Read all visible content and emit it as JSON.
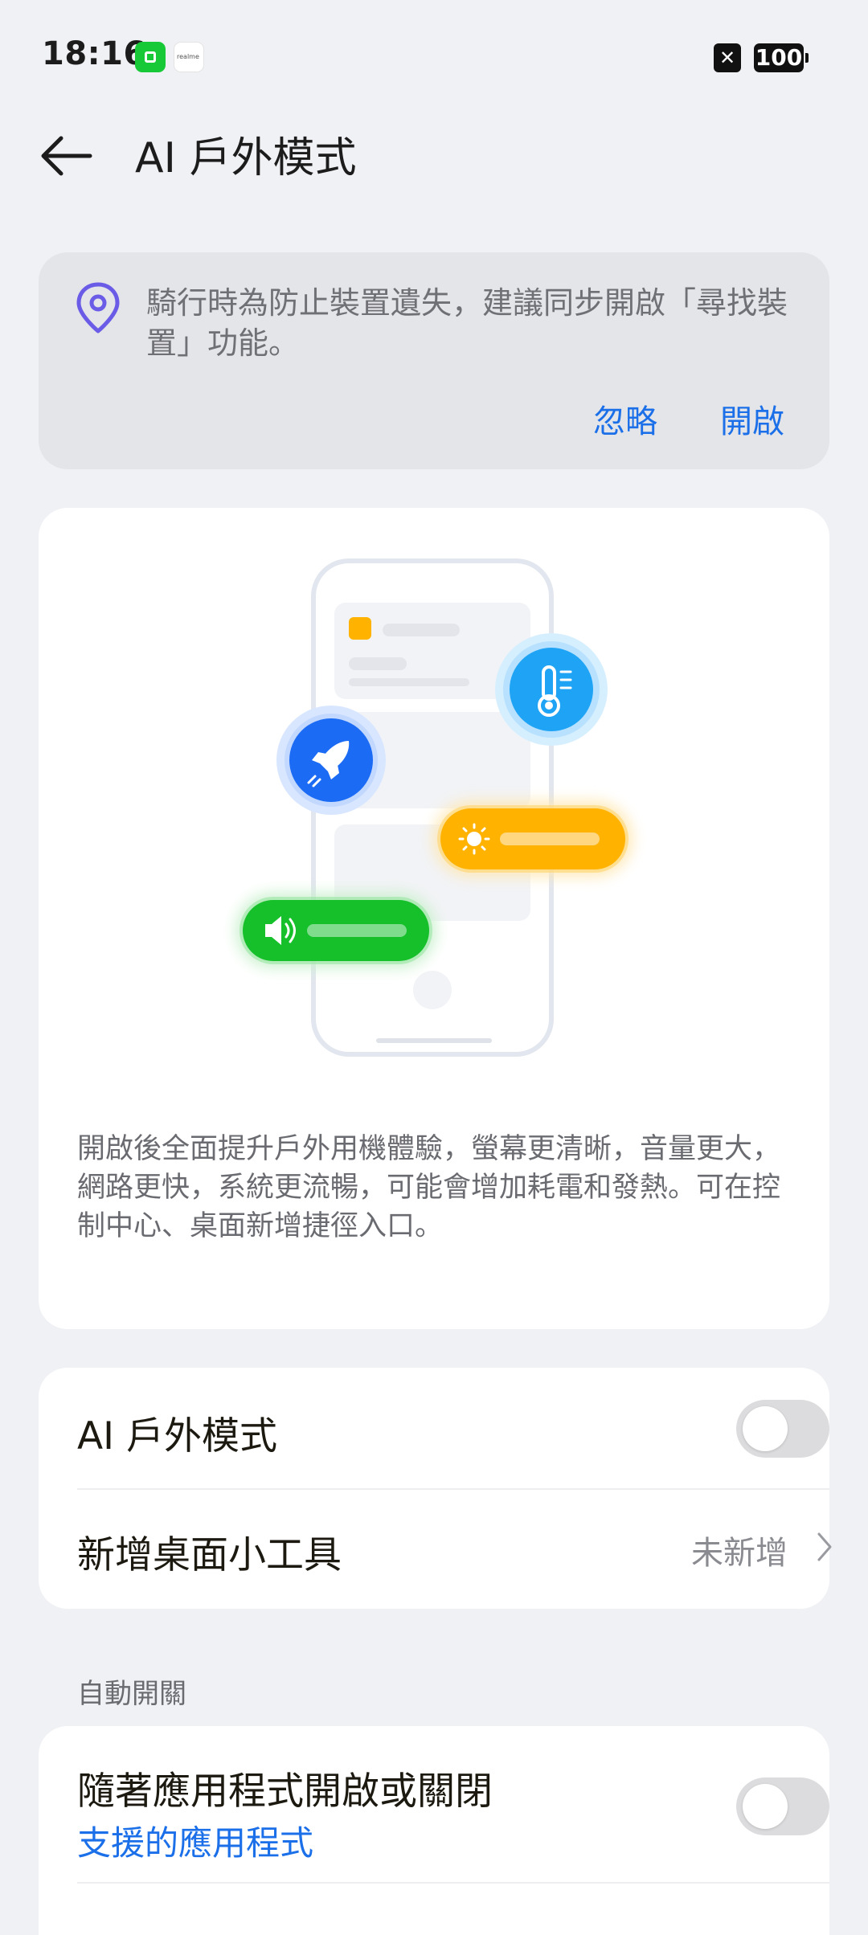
{
  "status_bar": {
    "time": "18:16",
    "notification_icons": [
      "green-app-icon",
      "realme-app-icon"
    ],
    "realme_label": "realme",
    "close_icon": "x-box-icon",
    "battery": "100"
  },
  "header": {
    "back_icon": "arrow-left-icon",
    "title": "AI 戶外模式"
  },
  "notice": {
    "icon": "location-pin-icon",
    "message": "騎行時為防止裝置遺失，建議同步開啟「尋找裝置」功能。",
    "ignore_label": "忽略",
    "open_label": "開啟",
    "accent": "#1b6fe8"
  },
  "illustration": {
    "icons": [
      "rocket-icon",
      "thermometer-icon",
      "sun-icon",
      "speaker-icon"
    ],
    "colors": {
      "rocket": "#1b6bf5",
      "thermo": "#1fa3f5",
      "sun": "#ffb300",
      "speaker": "#15c02a",
      "accent_square": "#ffb300"
    },
    "description": "開啟後全面提升戶外用機體驗，螢幕更清晰，音量更大，網路更快，系統更流暢，可能會增加耗電和發熱。可在控制中心、桌面新增捷徑入口。"
  },
  "settings": {
    "outdoor_mode": {
      "label": "AI 戶外模式",
      "on": false
    },
    "widget": {
      "label": "新增桌面小工具",
      "value": "未新增",
      "icon": "chevron-right-icon"
    }
  },
  "auto_switch": {
    "section_title": "自動開關",
    "with_apps": {
      "label": "隨著應用程式開啟或關閉",
      "link": "支援的應用程式",
      "on": false
    }
  }
}
